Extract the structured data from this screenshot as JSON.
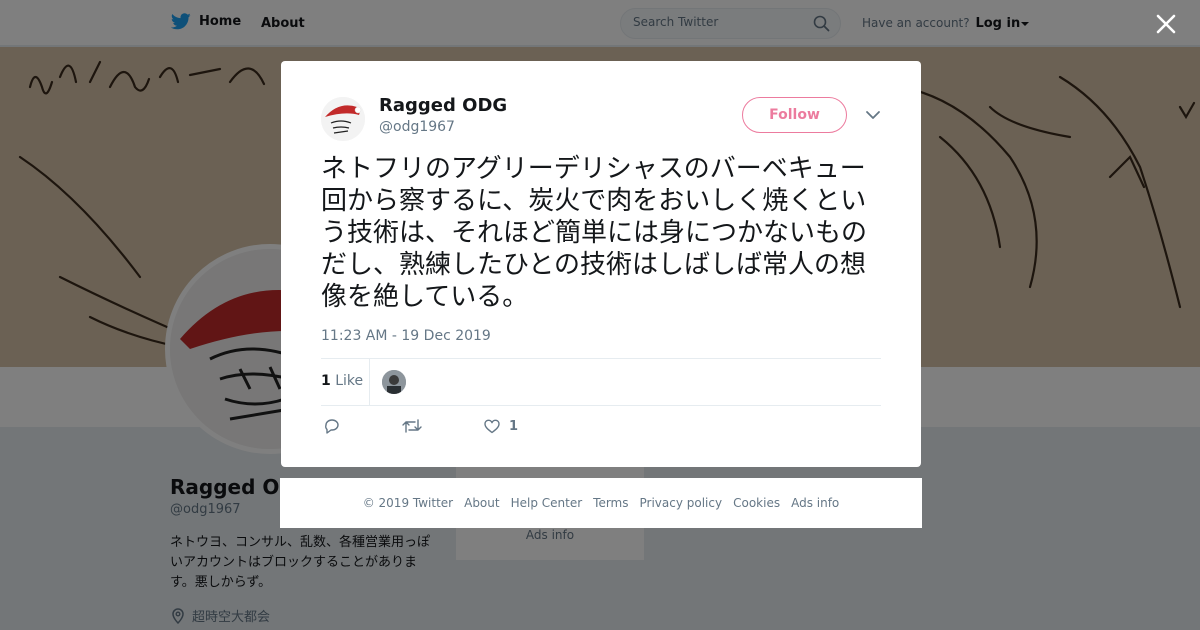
{
  "header": {
    "home_label": "Home",
    "about_label": "About",
    "search_placeholder": "Search Twitter",
    "account_prompt": "Have an account?",
    "login_label": "Log in"
  },
  "profile": {
    "name": "Ragged ODG",
    "handle": "@odg1967",
    "bio": "ネトウヨ、コンサル、乱数、各種営業用っぽいアカウントはブロックすることがあります。悪しからず。",
    "location": "超時空大都会",
    "side_ads_label": "Ads info"
  },
  "tweet": {
    "author_name": "Ragged ODG",
    "author_handle": "@odg1967",
    "follow_label": "Follow",
    "text": "ネトフリのアグリーデリシャスのバーベキュー回から察するに、炭火で肉をおいしく焼くという技術は、それほど簡単には身につかないものだし、熟練したひとの技術はしばしば常人の想像を絶している。",
    "timestamp": "11:23 AM - 19 Dec 2019",
    "like_count": "1",
    "like_word": "Like",
    "action_like_count": "1"
  },
  "footer": {
    "copyright": "© 2019 Twitter",
    "links": [
      "About",
      "Help Center",
      "Terms",
      "Privacy policy",
      "Cookies",
      "Ads info"
    ]
  },
  "colors": {
    "brand_blue": "#1da1f2",
    "follow_red": "#e0245e",
    "muted_gray": "#657786"
  },
  "icons": [
    "twitter-bird-icon",
    "search-icon",
    "close-icon",
    "chevron-down-icon",
    "reply-icon",
    "retweet-icon",
    "heart-icon",
    "location-pin-icon"
  ]
}
